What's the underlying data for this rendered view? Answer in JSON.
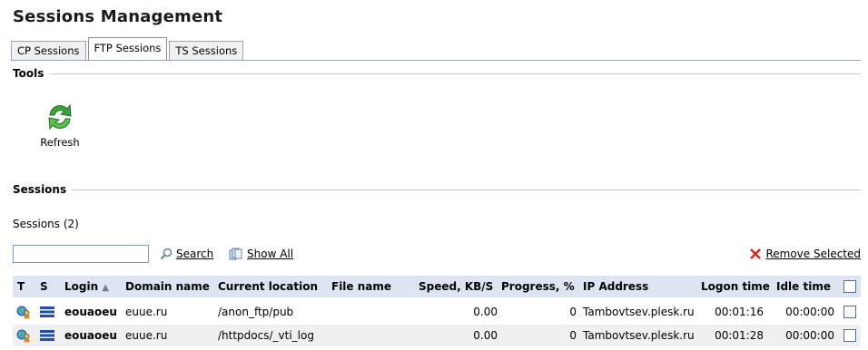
{
  "title": "Sessions Management",
  "tabs": [
    {
      "label": "CP Sessions",
      "active": false
    },
    {
      "label": "FTP Sessions",
      "active": true
    },
    {
      "label": "TS Sessions",
      "active": false
    }
  ],
  "tools": {
    "heading": "Tools",
    "refresh_label": "Refresh",
    "refresh_icon": "refresh-icon"
  },
  "sessions": {
    "heading": "Sessions",
    "count_label": "Sessions (2)",
    "search": {
      "value": "",
      "button_label": "Search",
      "show_all_label": "Show All"
    },
    "remove_selected_label": "Remove Selected",
    "columns": {
      "t": "T",
      "s": "S",
      "login": "Login",
      "domain": "Domain name",
      "location": "Current location",
      "file": "File name",
      "speed": "Speed, KB/S",
      "progress": "Progress, %",
      "ip": "IP Address",
      "logon": "Logon time",
      "idle": "Idle time"
    },
    "sort_indicator": "▲",
    "rows": [
      {
        "login": "eouaoeu",
        "domain": "euue.ru",
        "location": "/anon_ftp/pub",
        "file": "",
        "speed": "0.00",
        "progress": "0",
        "ip": "Tambovtsev.plesk.ru",
        "logon": "00:01:16",
        "idle": "00:00:00"
      },
      {
        "login": "eouaoeu",
        "domain": "euue.ru",
        "location": "/httpdocs/_vti_log",
        "file": "",
        "speed": "0.00",
        "progress": "0",
        "ip": "Tambovtsev.plesk.ru",
        "logon": "00:01:28",
        "idle": "00:00:00"
      }
    ]
  },
  "colors": {
    "header_bg": "#dde5f2",
    "remove_icon": "#d9261c",
    "refresh_icon": "#3aa33a"
  }
}
